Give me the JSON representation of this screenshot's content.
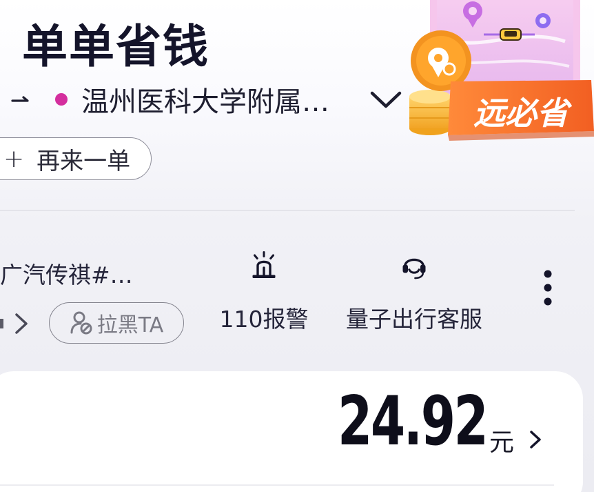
{
  "header": {
    "title": "单单省钱"
  },
  "route": {
    "destination": "温州医科大学附属…",
    "dest_dot_color": "#d42e9e"
  },
  "promo": {
    "label": "远必省"
  },
  "actions": {
    "reorder_label": "再来一单",
    "reorder_icon": "plus-icon"
  },
  "driver": {
    "car": "广汽传祺#广…",
    "block_label": "拉黑TA",
    "police_label": "110报警",
    "service_label": "量子出行客服"
  },
  "fare": {
    "amount": "24.92",
    "unit": "元"
  },
  "colors": {
    "accent_orange": "#f47a2c",
    "text_dark": "#14142a"
  }
}
